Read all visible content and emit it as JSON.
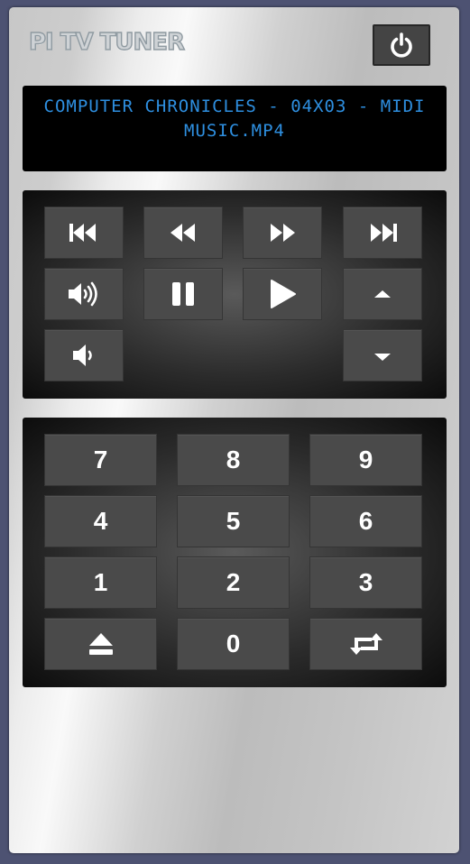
{
  "app": {
    "title": "PI TV TUNER"
  },
  "display": {
    "now_playing": "COMPUTER CHRONICLES - 04X03 - MIDI MUSIC.MP4"
  },
  "colors": {
    "display_text": "#2e8fe0",
    "button": "#4a4a4a",
    "panel_dark": "#0c0c0c",
    "body_bg": "#4d5272"
  },
  "transport": {
    "buttons": [
      {
        "name": "skip-previous",
        "icon": "skip-previous-icon"
      },
      {
        "name": "rewind",
        "icon": "rewind-icon"
      },
      {
        "name": "fast-forward",
        "icon": "fast-forward-icon"
      },
      {
        "name": "skip-next",
        "icon": "skip-next-icon"
      },
      {
        "name": "volume-up",
        "icon": "volume-up-icon"
      },
      {
        "name": "pause",
        "icon": "pause-icon"
      },
      {
        "name": "play",
        "icon": "play-icon"
      },
      {
        "name": "channel-up",
        "icon": "caret-up-icon"
      },
      {
        "name": "volume-down",
        "icon": "volume-down-icon"
      },
      {
        "name": "channel-down",
        "icon": "caret-down-icon"
      }
    ]
  },
  "keypad": {
    "digits": {
      "k7": "7",
      "k8": "8",
      "k9": "9",
      "k4": "4",
      "k5": "5",
      "k6": "6",
      "k1": "1",
      "k2": "2",
      "k3": "3",
      "k0": "0"
    },
    "extra": [
      {
        "name": "eject",
        "icon": "eject-icon"
      },
      {
        "name": "repeat",
        "icon": "repeat-icon"
      }
    ]
  }
}
